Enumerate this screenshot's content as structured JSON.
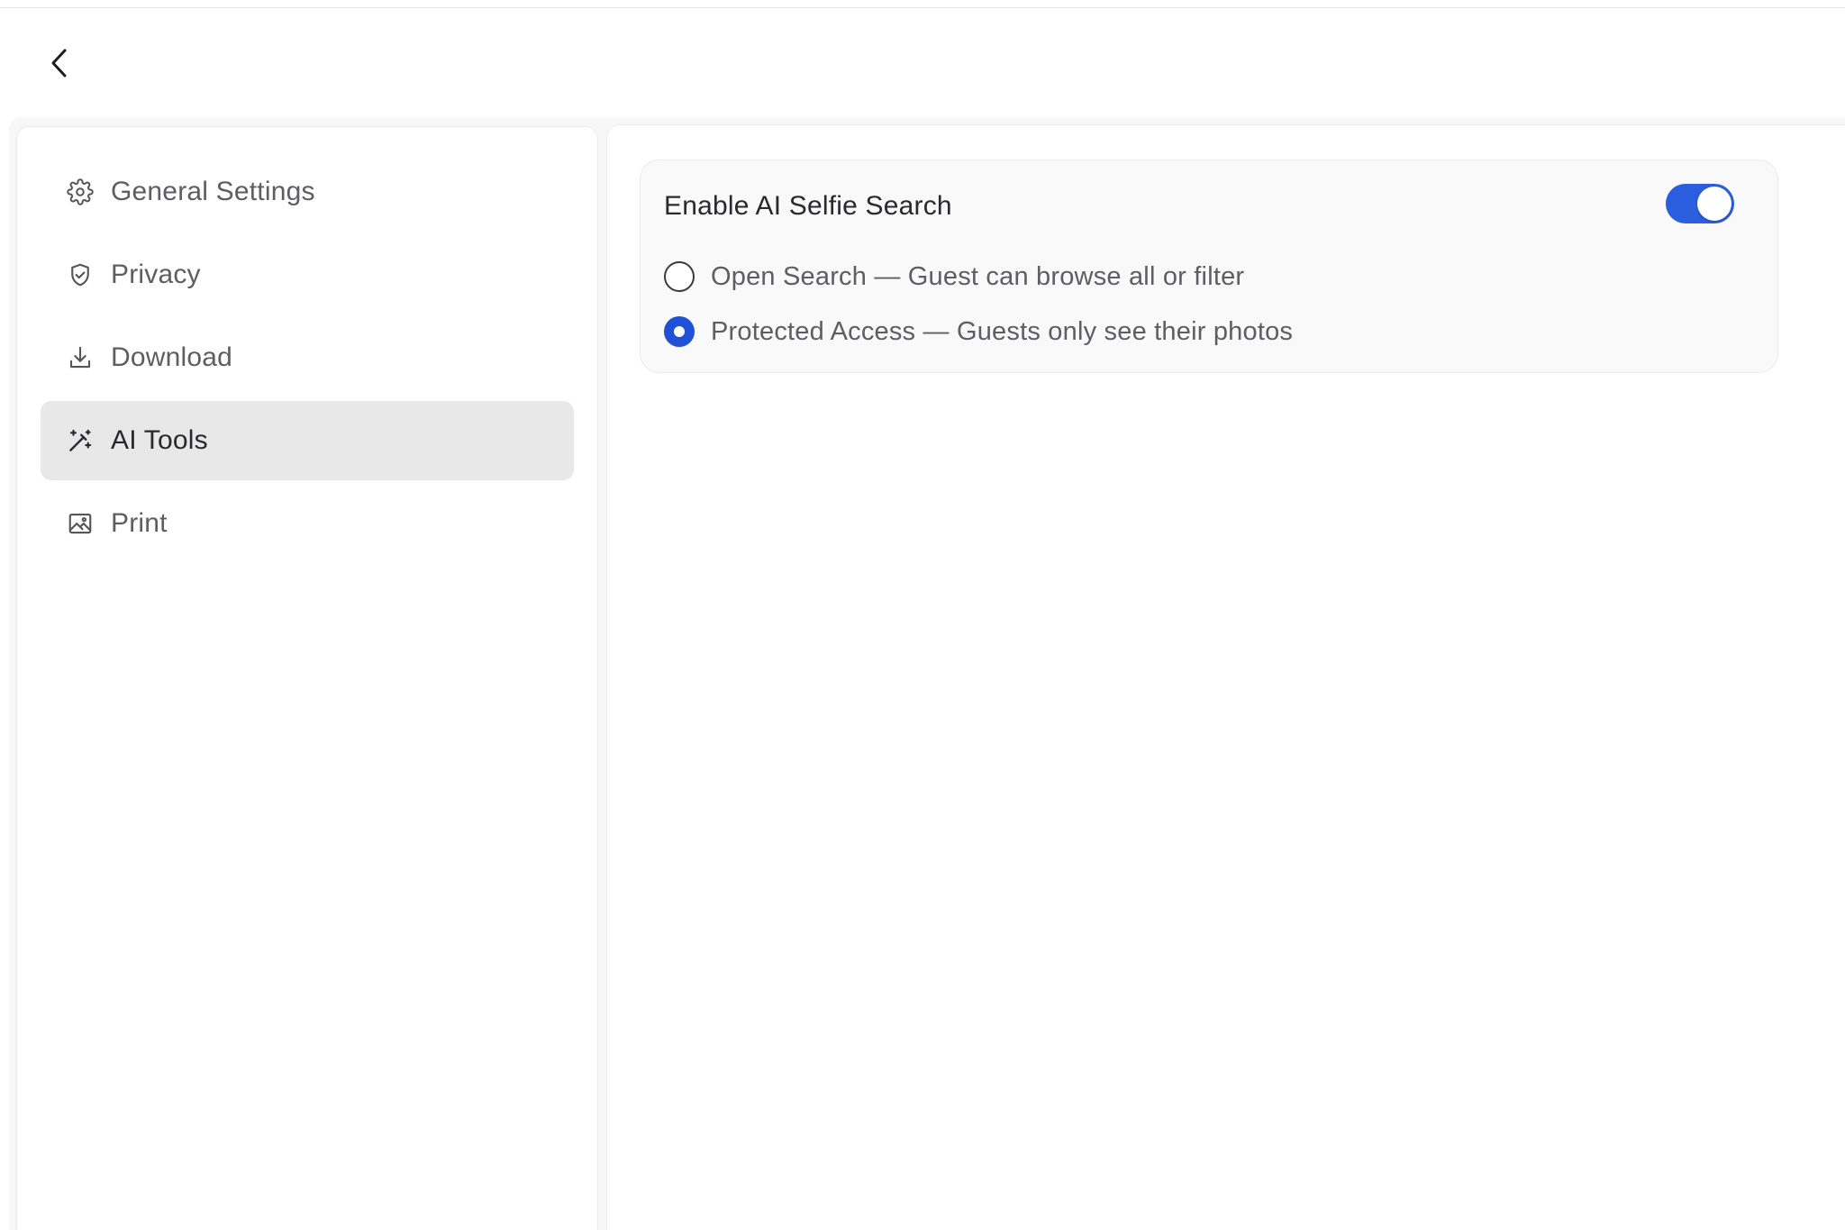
{
  "header": {
    "back_icon": "chevron-left-icon"
  },
  "sidebar": {
    "items": [
      {
        "label": "General Settings",
        "icon": "gear-icon",
        "active": false
      },
      {
        "label": "Privacy",
        "icon": "shield-check-icon",
        "active": false
      },
      {
        "label": "Download",
        "icon": "download-icon",
        "active": false
      },
      {
        "label": "AI Tools",
        "icon": "magic-wand-icon",
        "active": true
      },
      {
        "label": "Print",
        "icon": "image-icon",
        "active": false
      }
    ]
  },
  "main": {
    "ai_card": {
      "title": "Enable AI Selfie Search",
      "toggle_on": true,
      "options": [
        {
          "label": "Open Search — Guest can browse all or filter",
          "selected": false
        },
        {
          "label": "Protected Access — Guests only see their photos",
          "selected": true
        }
      ]
    }
  },
  "colors": {
    "accent": "#2b5fe0",
    "radio_selected": "#1f50d6",
    "active_nav_bg": "#e8e8e8"
  }
}
